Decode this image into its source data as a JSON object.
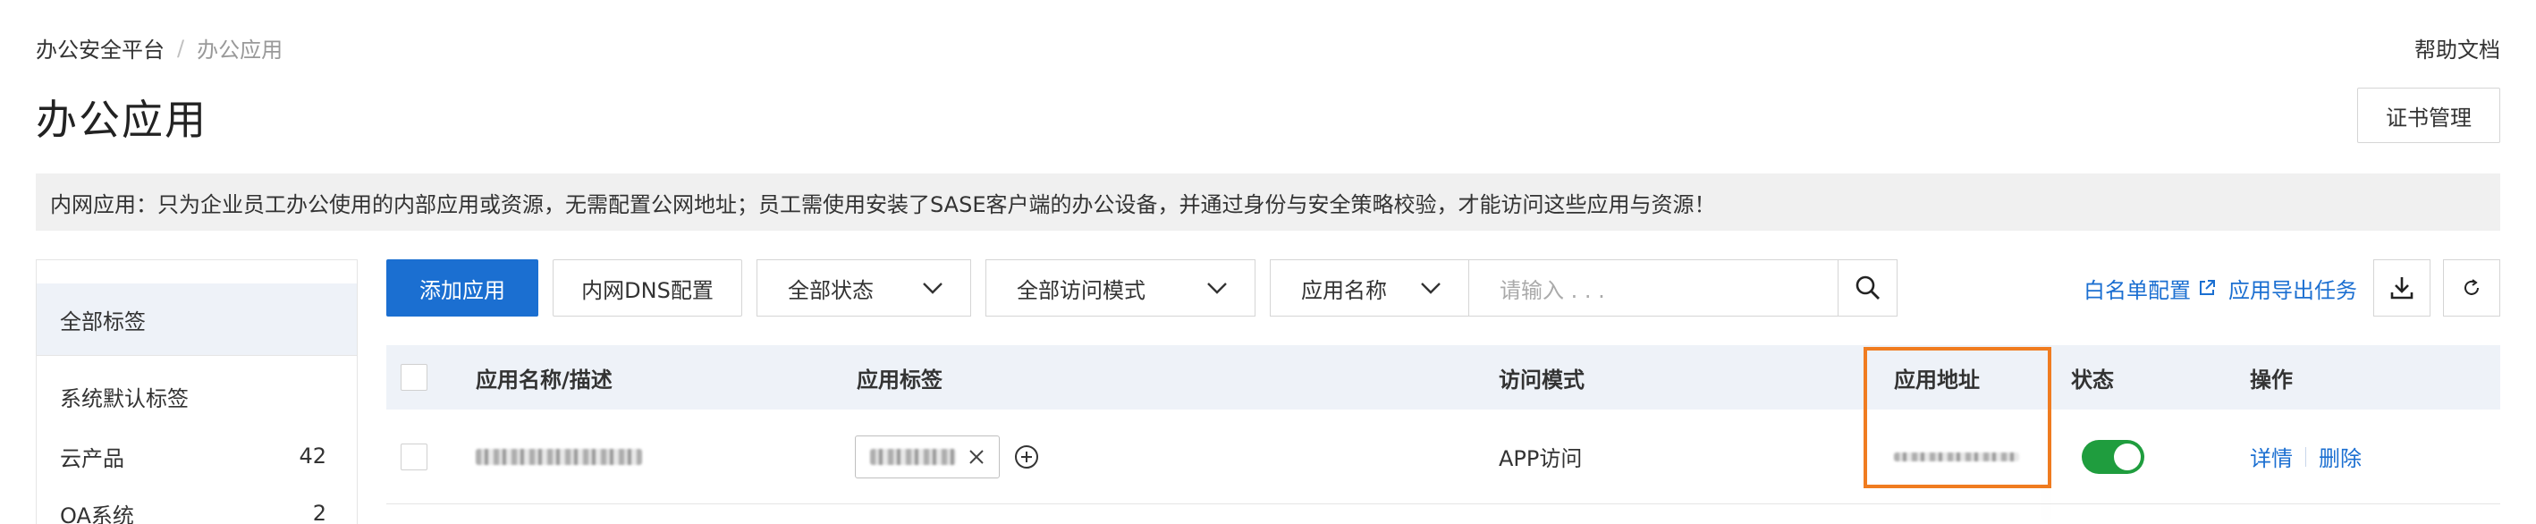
{
  "breadcrumb": {
    "root": "办公安全平台",
    "sep": "/",
    "current": "办公应用"
  },
  "help_link": "帮助文档",
  "page_title": "办公应用",
  "cert_button": "证书管理",
  "notice": "内网应用：只为企业员工办公使用的内部应用或资源，无需配置公网地址；员工需使用安装了SASE客户端的办公设备，并通过身份与安全策略校验，才能访问这些应用与资源！",
  "sidebar": {
    "all": "全部标签",
    "group": "系统默认标签",
    "items": [
      {
        "label": "云产品",
        "count": "42"
      },
      {
        "label": "OA系统",
        "count": "2"
      }
    ]
  },
  "toolbar": {
    "add": "添加应用",
    "dns": "内网DNS配置",
    "status_select": "全部状态",
    "mode_select": "全部访问模式",
    "field_select": "应用名称",
    "search_placeholder": "请输入 . . ."
  },
  "right_tools": {
    "whitelist": "白名单配置",
    "export": "应用导出任务"
  },
  "table": {
    "headers": [
      "应用名称/描述",
      "应用标签",
      "访问模式",
      "应用地址",
      "状态",
      "操作"
    ],
    "rows": [
      {
        "access_mode": "APP访问",
        "status_on": true,
        "ops": [
          "详情",
          "删除"
        ]
      }
    ]
  },
  "colors": {
    "primary": "#1b6fd1",
    "toggle_on": "#1f9d3e",
    "highlight": "#f07c20"
  }
}
